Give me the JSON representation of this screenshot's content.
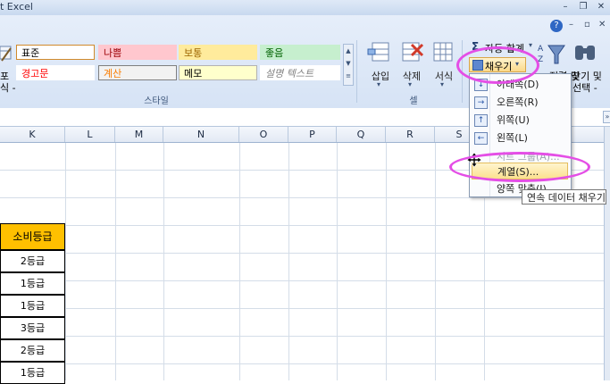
{
  "window": {
    "title": "t Excel",
    "controls": [
      "–",
      "❐",
      "✕"
    ],
    "help": "?",
    "ribbon_controls": [
      "–",
      "▫",
      "✕"
    ]
  },
  "styles": {
    "group_label": "스타일",
    "left_button_lines": [
      "포",
      "식 -"
    ],
    "cells": [
      {
        "label": "표준",
        "bg": "#ffffff",
        "color": "#000000",
        "border": "#d08a2c"
      },
      {
        "label": "나쁨",
        "bg": "#ffc7ce",
        "color": "#9c0006",
        "border": "#ffc7ce"
      },
      {
        "label": "보통",
        "bg": "#ffeb9c",
        "color": "#9c6500",
        "border": "#ffeb9c"
      },
      {
        "label": "좋음",
        "bg": "#c6efce",
        "color": "#006100",
        "border": "#c6efce"
      },
      {
        "label": "경고문",
        "bg": "#ffffff",
        "color": "#ff0000",
        "border": "#ffffff"
      },
      {
        "label": "계산",
        "bg": "#f2f2f2",
        "color": "#fa7d00",
        "border": "#7f7f7f"
      },
      {
        "label": "메모",
        "bg": "#ffffcc",
        "color": "#000000",
        "border": "#b2b2b2"
      },
      {
        "label": "설명 텍스트",
        "bg": "#ffffff",
        "color": "#7f7f7f",
        "border": "#ffffff"
      }
    ]
  },
  "cells_group": {
    "group_label": "셀",
    "insert": "삽입",
    "delete": "삭제",
    "format": "서식"
  },
  "editing": {
    "autosum": "자동 합계",
    "fill": "채우기",
    "sort_label": "정렬 및",
    "find_label": "찾기 및",
    "find_sub": "선택 -"
  },
  "fill_menu": [
    {
      "label": "아래쪽(D)",
      "icon": "↓",
      "disabled": false,
      "highlight": false
    },
    {
      "label": "오른쪽(R)",
      "icon": "→",
      "disabled": false,
      "highlight": false
    },
    {
      "label": "위쪽(U)",
      "icon": "↑",
      "disabled": false,
      "highlight": false
    },
    {
      "label": "왼쪽(L)",
      "icon": "←",
      "disabled": false,
      "highlight": false
    },
    {
      "label": "시트 그룹(A)...",
      "icon": "",
      "disabled": true,
      "highlight": false
    },
    {
      "label": "계열(S)...",
      "icon": "",
      "disabled": false,
      "highlight": true
    },
    {
      "label": "양쪽 맞춤(J)",
      "icon": "",
      "disabled": false,
      "highlight": false
    }
  ],
  "tooltip": "연속 데이터 채우기",
  "grid": {
    "columns": [
      "K",
      "L",
      "M",
      "N",
      "O",
      "P",
      "Q",
      "R",
      "S"
    ],
    "header_cell": "소비등급",
    "rows": [
      "2등급",
      "1등급",
      "1등급",
      "3등급",
      "2등급",
      "1등급"
    ]
  },
  "colors": {
    "highlight_ring": "#e44ee6",
    "header_fill": "#ffc000"
  }
}
